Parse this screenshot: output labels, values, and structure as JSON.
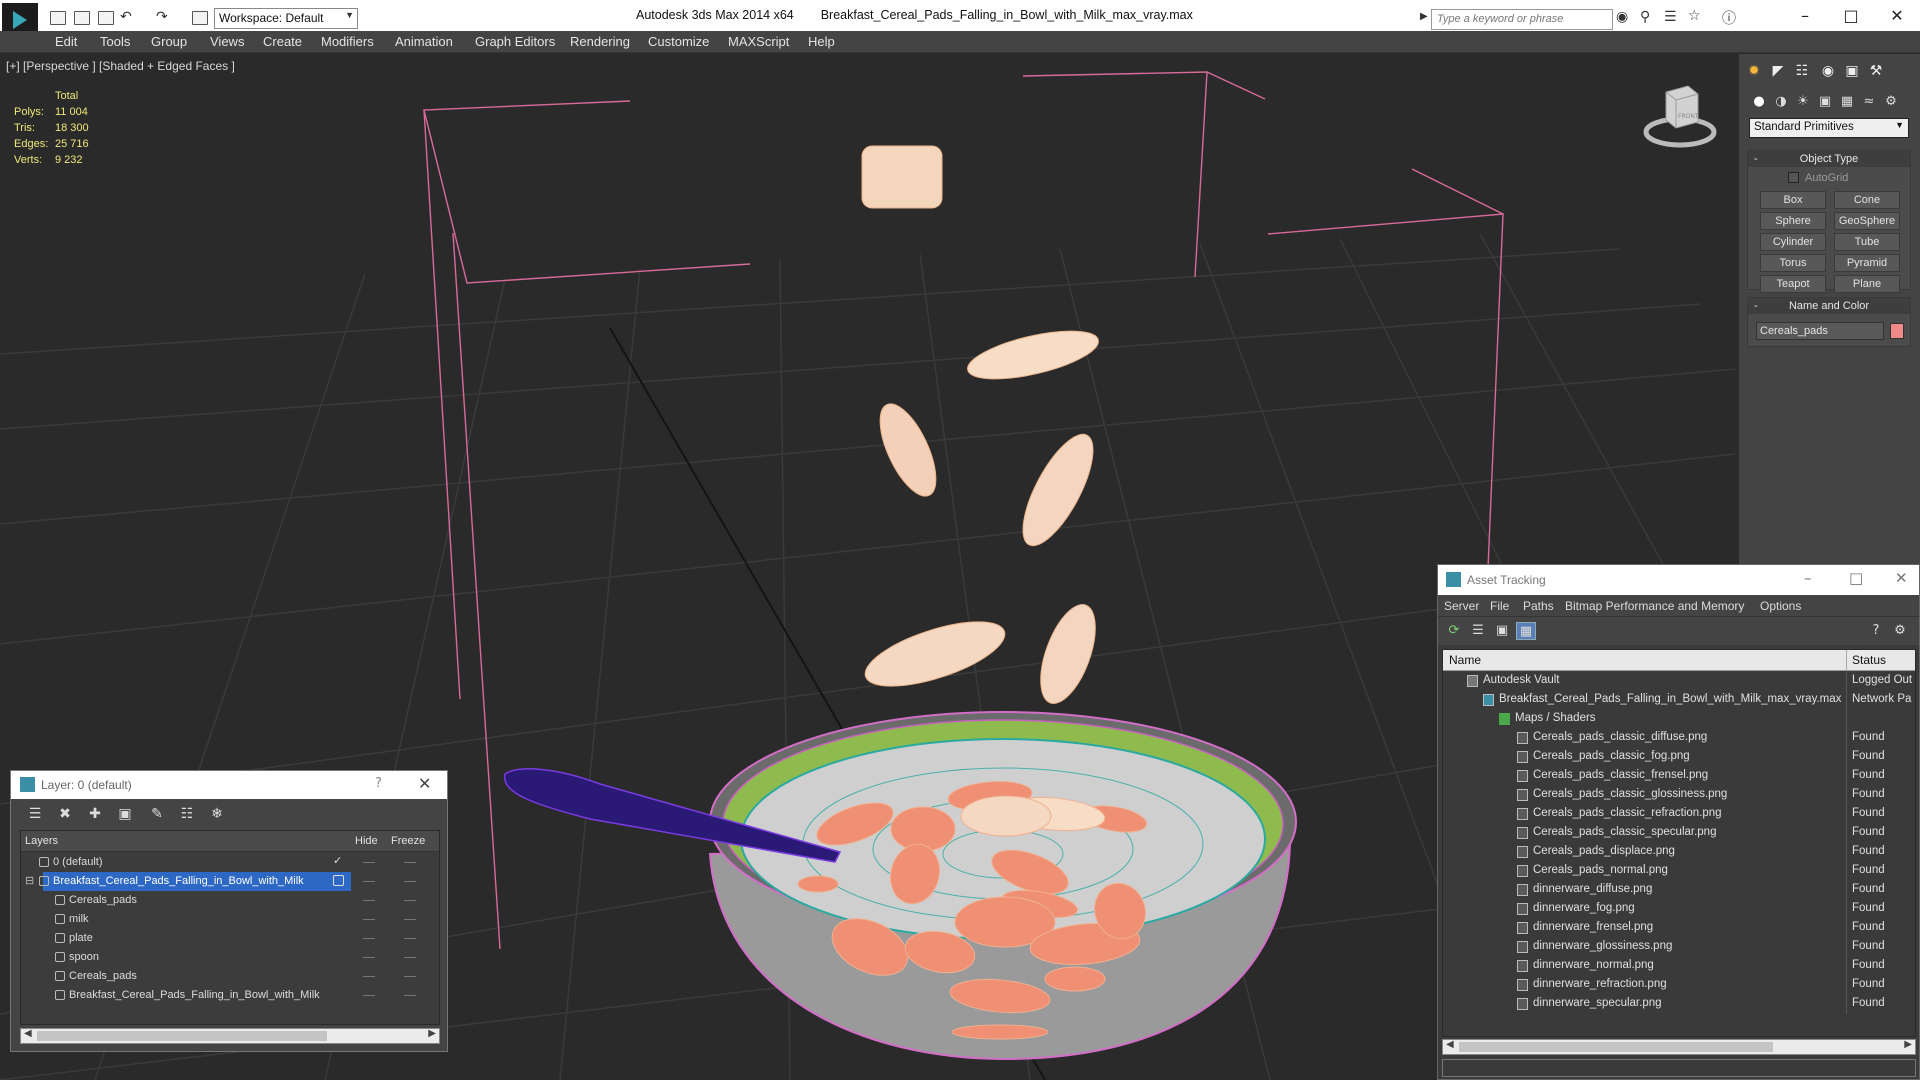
{
  "titlebar": {
    "workspace": "Workspace: Default",
    "app_name": "Autodesk 3ds Max  2014 x64",
    "file_name": "Breakfast_Cereal_Pads_Falling_in_Bowl_with_Milk_max_vray.max",
    "search_placeholder": "Type a keyword or phrase"
  },
  "menu": [
    "Edit",
    "Tools",
    "Group",
    "Views",
    "Create",
    "Modifiers",
    "Animation",
    "Graph Editors",
    "Rendering",
    "Customize",
    "MAXScript",
    "Help"
  ],
  "viewport": {
    "label": "[+] [Perspective ] [Shaded + Edged Faces ]",
    "stats": {
      "total_label": "Total",
      "rows": [
        {
          "key": "Polys:",
          "value": "11 004"
        },
        {
          "key": "Tris:",
          "value": "18 300"
        },
        {
          "key": "Edges:",
          "value": "25 716"
        },
        {
          "key": "Verts:",
          "value": "9 232"
        }
      ]
    },
    "viewcube_label": "FRONT"
  },
  "command_panel": {
    "dropdown": "Standard Primitives",
    "object_type": {
      "title": "Object Type",
      "autogrid": "AutoGrid",
      "buttons": [
        "Box",
        "Cone",
        "Sphere",
        "GeoSphere",
        "Cylinder",
        "Tube",
        "Torus",
        "Pyramid",
        "Teapot",
        "Plane"
      ]
    },
    "name_and_color": {
      "title": "Name and Color",
      "name": "Cereals_pads",
      "color": "#f08a8a"
    }
  },
  "layer_dialog": {
    "title": "Layer: 0 (default)",
    "columns": {
      "layers": "Layers",
      "hide": "Hide",
      "freeze": "Freeze"
    },
    "rows": [
      {
        "name": "0 (default)"
      },
      {
        "name": "Breakfast_Cereal_Pads_Falling_in_Bowl_with_Milk"
      },
      {
        "name": "Cereals_pads"
      },
      {
        "name": "milk"
      },
      {
        "name": "plate"
      },
      {
        "name": "spoon"
      },
      {
        "name": "Cereals_pads"
      },
      {
        "name": "Breakfast_Cereal_Pads_Falling_in_Bowl_with_Milk"
      }
    ]
  },
  "asset_tracking": {
    "title": "Asset Tracking",
    "menu": [
      "Server",
      "File",
      "Paths",
      "Bitmap Performance and Memory",
      "Options"
    ],
    "columns": {
      "name": "Name",
      "status": "Status"
    },
    "rows": [
      {
        "name": "Autodesk Vault",
        "status": "Logged Out"
      },
      {
        "name": "Breakfast_Cereal_Pads_Falling_in_Bowl_with_Milk_max_vray.max",
        "status": "Network Pa"
      },
      {
        "name": "Maps / Shaders",
        "status": ""
      },
      {
        "name": "Cereals_pads_classic_diffuse.png",
        "status": "Found"
      },
      {
        "name": "Cereals_pads_classic_fog.png",
        "status": "Found"
      },
      {
        "name": "Cereals_pads_classic_frensel.png",
        "status": "Found"
      },
      {
        "name": "Cereals_pads_classic_glossiness.png",
        "status": "Found"
      },
      {
        "name": "Cereals_pads_classic_refraction.png",
        "status": "Found"
      },
      {
        "name": "Cereals_pads_classic_specular.png",
        "status": "Found"
      },
      {
        "name": "Cereals_pads_displace.png",
        "status": "Found"
      },
      {
        "name": "Cereals_pads_normal.png",
        "status": "Found"
      },
      {
        "name": "dinnerware_diffuse.png",
        "status": "Found"
      },
      {
        "name": "dinnerware_fog.png",
        "status": "Found"
      },
      {
        "name": "dinnerware_frensel.png",
        "status": "Found"
      },
      {
        "name": "dinnerware_glossiness.png",
        "status": "Found"
      },
      {
        "name": "dinnerware_normal.png",
        "status": "Found"
      },
      {
        "name": "dinnerware_refraction.png",
        "status": "Found"
      },
      {
        "name": "dinnerware_specular.png",
        "status": "Found"
      }
    ]
  }
}
